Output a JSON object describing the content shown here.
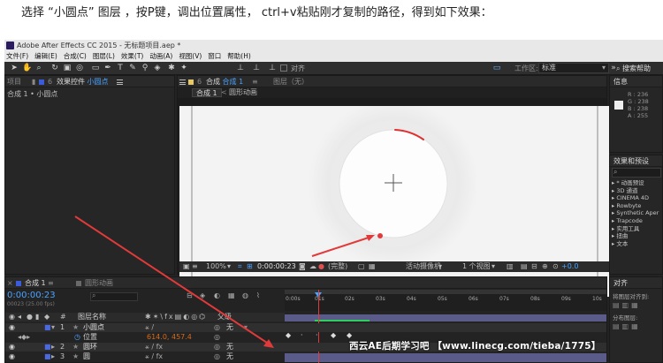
{
  "caption": "选择 “小圆点” 图层 ，按P键，调出位置属性， ctrl+v粘贴刚才复制的路径，得到如下效果：",
  "window": {
    "title": "Adobe After Effects CC 2015 - 无标题项目.aep *"
  },
  "menu": [
    "文件(F)",
    "编辑(E)",
    "合成(C)",
    "图层(L)",
    "效果(T)",
    "动画(A)",
    "视图(V)",
    "窗口",
    "帮助(H)"
  ],
  "toolbar": {
    "align_label": "对齐",
    "workspace_label": "工作区:",
    "workspace_value": "标准",
    "search_help": "搜索帮助",
    "tool_icons": [
      "selection-icon",
      "hand-icon",
      "zoom-icon",
      "rotate-icon",
      "camera-icon",
      "pan-behind-icon",
      "rectangle-icon",
      "pen-icon",
      "type-icon",
      "brush-icon",
      "clone-icon",
      "eraser-icon",
      "roto-icon",
      "puppet-icon"
    ]
  },
  "project_panel": {
    "tab_project": "项目",
    "tab_effects": "效果控件",
    "layer_name": "小圆点",
    "breadcrumb": "合成 1 • 小圆点"
  },
  "comp_panel": {
    "tab_label": "合成",
    "comp_name": "合成 1",
    "layer_tab": "图层（无）",
    "breadcrumb_1": "合成 1",
    "breadcrumb_2": "圆形动画",
    "zoom": "100%",
    "timecode": "0:00:00:23",
    "resolution": "(完整)",
    "camera": "活动摄像机",
    "views": "1 个视图",
    "exposure": "+0.0"
  },
  "info_panel": {
    "title": "信息",
    "r": "R : 236",
    "g": "G : 238",
    "b": "B : 238",
    "a": "A : 255"
  },
  "effects_panel": {
    "title": "效果和预设",
    "items": [
      "* 动画预设",
      "3D 通道",
      "CINEMA 4D",
      "Rowbyte",
      "Synthetic Aper",
      "Trapcode",
      "实用工具",
      "扭曲",
      "文本"
    ]
  },
  "align_panel": {
    "title": "对齐",
    "align_to": "将图层对齐到:",
    "distribute": "分布图层:"
  },
  "timeline": {
    "tab_1": "合成 1",
    "tab_2": "圆形动画",
    "timecode": "0:00:00:23",
    "frame_info": "00023 (25.00 fps)",
    "col_layer_name": "图层名称",
    "col_parent": "父级",
    "ruler_ticks": [
      "0:00s",
      "01s",
      "02s",
      "03s",
      "04s",
      "05s",
      "06s",
      "07s",
      "08s",
      "09s",
      "10s"
    ],
    "layers": [
      {
        "num": "1",
        "name": "小圆点",
        "parent": "无"
      },
      {
        "num": "2",
        "name": "圆环",
        "parent": "无"
      },
      {
        "num": "3",
        "name": "圆",
        "parent": "无"
      }
    ],
    "position_label": "位置",
    "position_value": "614.0, 457.4"
  },
  "watermark": "西云AE后期学习吧 【www.linecg.com/tieba/1775】"
}
